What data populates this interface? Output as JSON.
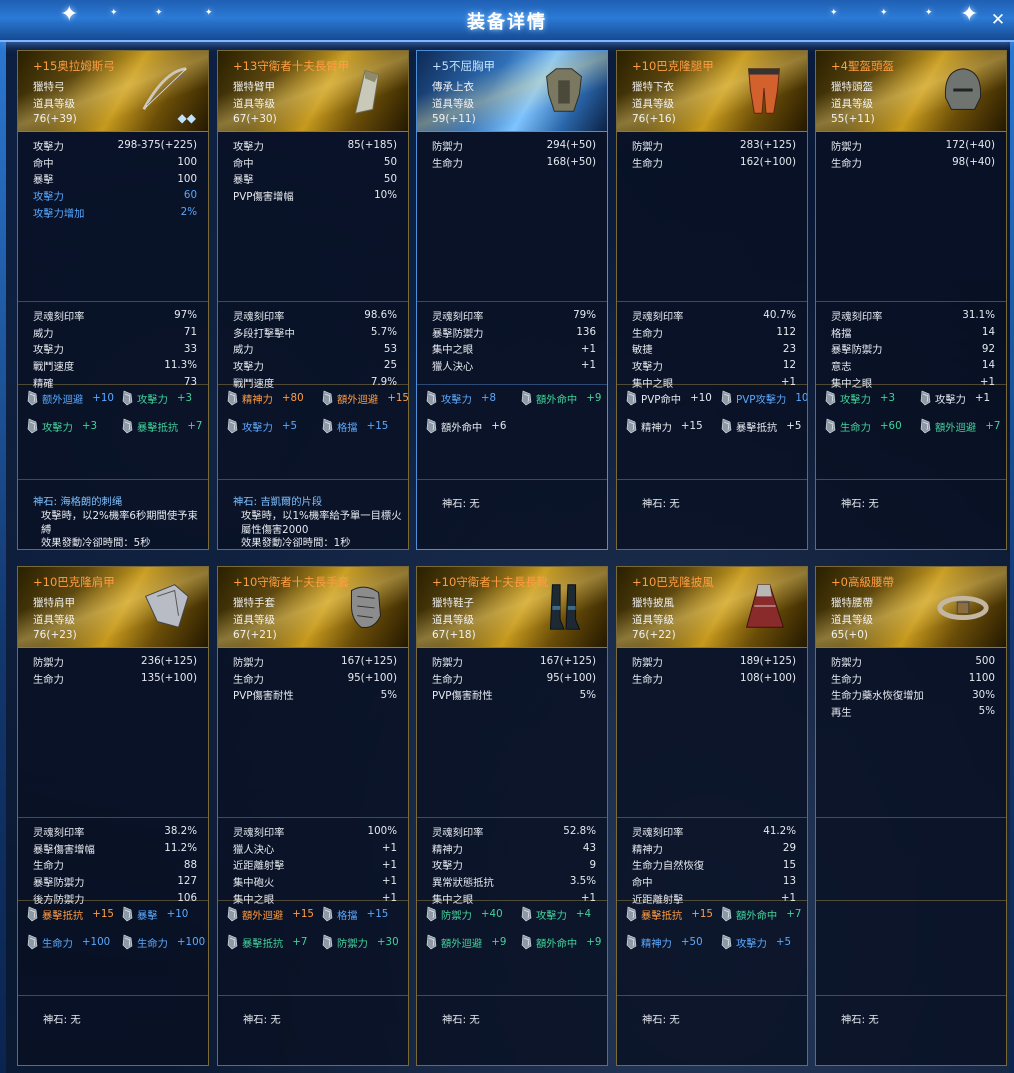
{
  "title": "装备详情",
  "cards": [
    {
      "theme": "gold",
      "name": "+15奥拉姆斯弓",
      "type": "獵特弓",
      "level_label": "道具等级",
      "level": "76(+39)",
      "stats": [
        [
          "攻擊力",
          "298-375(+225)"
        ],
        [
          "命中",
          "100"
        ],
        [
          "暴擊",
          "100"
        ],
        [
          "攻擊力",
          "60"
        ],
        [
          "攻擊力增加",
          "2%"
        ]
      ],
      "soul": [
        [
          "灵魂刻印率",
          "97%"
        ],
        [
          "威力",
          "71"
        ],
        [
          "攻擊力",
          "33"
        ],
        [
          "戰鬥速度",
          "11.3%"
        ],
        [
          "精確",
          "73"
        ]
      ],
      "bonus": [
        [
          "额外迴避",
          "+10",
          "blue"
        ],
        [
          "攻擊力",
          "+3",
          "green"
        ],
        [
          "攻擊力",
          "+3",
          "green"
        ],
        [
          "暴擊抵抗",
          "+7",
          "green"
        ]
      ],
      "stone": {
        "title": "神石: 海格朗的刺绳",
        "desc": "攻擊時，以2%機率6秒期間使予束縛\n效果發動冷卻時間：5秒\n穿戴多個相同的神石時，僅套用一個效果。"
      }
    },
    {
      "theme": "gold",
      "name": "+13守衛者十夫長臂甲",
      "type": "獵特臂甲",
      "level_label": "道具等级",
      "level": "67(+30)",
      "stats": [
        [
          "攻擊力",
          "85(+185)"
        ],
        [
          "命中",
          "50"
        ],
        [
          "暴擊",
          "50"
        ],
        [
          "PVP傷害增幅",
          "10%"
        ]
      ],
      "soul": [
        [
          "灵魂刻印率",
          "98.6%"
        ],
        [
          "多段打擊擊中",
          "5.7%"
        ],
        [
          "威力",
          "53"
        ],
        [
          "攻擊力",
          "25"
        ],
        [
          "戰鬥速度",
          "7.9%"
        ]
      ],
      "bonus": [
        [
          "精神力",
          "+80",
          "orange"
        ],
        [
          "額外迴避",
          "+15",
          "orange"
        ],
        [
          "攻擊力",
          "+5",
          "blue"
        ],
        [
          "格擋",
          "+15",
          "blue"
        ]
      ],
      "stone": {
        "title": "神石: 吉凱爾的片段",
        "desc": "攻擊時，以1%機率給予單一目標火屬性傷害2000\n效果發動冷卻時間：1秒\n穿戴多個相同的神石時，僅套用一個效果。"
      }
    },
    {
      "theme": "blue",
      "name": "+5不屈胸甲",
      "type": "傳承上衣",
      "level_label": "道具等级",
      "level": "59(+11)",
      "stats": [
        [
          "防禦力",
          "294(+50)"
        ],
        [
          "生命力",
          "168(+50)"
        ]
      ],
      "soul": [
        [
          "灵魂刻印率",
          "79%"
        ],
        [
          "暴擊防禦力",
          "136"
        ],
        [
          "集中之眼",
          "+1"
        ],
        [
          "獵人決心",
          "+1"
        ]
      ],
      "bonus": [
        [
          "攻擊力",
          "+8",
          "blue"
        ],
        [
          "額外命中",
          "+9",
          "green"
        ],
        [
          "額外命中",
          "+6",
          "white"
        ]
      ],
      "stone": {
        "title": "神石: 无",
        "desc": ""
      }
    },
    {
      "theme": "gold",
      "name": "+10巴克隆腿甲",
      "type": "獵特下衣",
      "level_label": "道具等级",
      "level": "76(+16)",
      "stats": [
        [
          "防禦力",
          "283(+125)"
        ],
        [
          "生命力",
          "162(+100)"
        ]
      ],
      "soul": [
        [
          "灵魂刻印率",
          "40.7%"
        ],
        [
          "生命力",
          "112"
        ],
        [
          "敏捷",
          "23"
        ],
        [
          "攻擊力",
          "12"
        ],
        [
          "集中之眼",
          "+1"
        ]
      ],
      "bonus": [
        [
          "PVP命中",
          "+10",
          "white"
        ],
        [
          "PVP攻擊力",
          "10",
          "blue"
        ],
        [
          "精神力",
          "+15",
          "white"
        ],
        [
          "暴擊抵抗",
          "+5",
          "white"
        ]
      ],
      "stone": {
        "title": "神石: 无",
        "desc": ""
      }
    },
    {
      "theme": "gold",
      "name": "+4聖盔頭盔",
      "type": "獵特頭盔",
      "level_label": "道具等级",
      "level": "55(+11)",
      "stats": [
        [
          "防禦力",
          "172(+40)"
        ],
        [
          "生命力",
          "98(+40)"
        ]
      ],
      "soul": [
        [
          "灵魂刻印率",
          "31.1%"
        ],
        [
          "格擋",
          "14"
        ],
        [
          "暴擊防禦力",
          "92"
        ],
        [
          "意志",
          "14"
        ],
        [
          "集中之眼",
          "+1"
        ]
      ],
      "bonus": [
        [
          "攻擊力",
          "+3",
          "green"
        ],
        [
          "攻擊力",
          "+1",
          "white"
        ],
        [
          "生命力",
          "+60",
          "green"
        ],
        [
          "額外迴避",
          "+7",
          "green"
        ]
      ],
      "stone": {
        "title": "神石: 无",
        "desc": ""
      }
    },
    {
      "theme": "gold",
      "name": "+10巴克隆肩甲",
      "type": "獵特肩甲",
      "level_label": "道具等级",
      "level": "76(+23)",
      "stats": [
        [
          "防禦力",
          "236(+125)"
        ],
        [
          "生命力",
          "135(+100)"
        ]
      ],
      "soul": [
        [
          "灵魂刻印率",
          "38.2%"
        ],
        [
          "暴擊傷害增幅",
          "11.2%"
        ],
        [
          "生命力",
          "88"
        ],
        [
          "暴擊防禦力",
          "127"
        ],
        [
          "後方防禦力",
          "106"
        ]
      ],
      "bonus": [
        [
          "暴擊抵抗",
          "+15",
          "orange"
        ],
        [
          "暴擊",
          "+10",
          "blue"
        ],
        [
          "生命力",
          "+100",
          "blue"
        ],
        [
          "生命力",
          "+100",
          "blue"
        ]
      ],
      "stone": {
        "title": "神石: 无",
        "desc": ""
      }
    },
    {
      "theme": "gold",
      "name": "+10守衛者十夫長手套",
      "type": "獵特手套",
      "level_label": "道具等级",
      "level": "67(+21)",
      "stats": [
        [
          "防禦力",
          "167(+125)"
        ],
        [
          "生命力",
          "95(+100)"
        ],
        [
          "PVP傷害耐性",
          "5%"
        ]
      ],
      "soul": [
        [
          "灵魂刻印率",
          "100%"
        ],
        [
          "獵人決心",
          "+1"
        ],
        [
          "近距離射擊",
          "+1"
        ],
        [
          "集中砲火",
          "+1"
        ],
        [
          "集中之眼",
          "+1"
        ]
      ],
      "bonus": [
        [
          "額外迴避",
          "+15",
          "orange"
        ],
        [
          "格擋",
          "+15",
          "blue"
        ],
        [
          "暴擊抵抗",
          "+7",
          "green"
        ],
        [
          "防禦力",
          "+30",
          "green"
        ]
      ],
      "stone": {
        "title": "神石: 无",
        "desc": ""
      }
    },
    {
      "theme": "gold",
      "name": "+10守衛者十夫長長靴",
      "type": "獵特鞋子",
      "level_label": "道具等级",
      "level": "67(+18)",
      "stats": [
        [
          "防禦力",
          "167(+125)"
        ],
        [
          "生命力",
          "95(+100)"
        ],
        [
          "PVP傷害耐性",
          "5%"
        ]
      ],
      "soul": [
        [
          "灵魂刻印率",
          "52.8%"
        ],
        [
          "精神力",
          "43"
        ],
        [
          "攻擊力",
          "9"
        ],
        [
          "異常狀態抵抗",
          "3.5%"
        ],
        [
          "集中之眼",
          "+1"
        ]
      ],
      "bonus": [
        [
          "防禦力",
          "+40",
          "green"
        ],
        [
          "攻擊力",
          "+4",
          "green"
        ],
        [
          "額外迴避",
          "+9",
          "green"
        ],
        [
          "額外命中",
          "+9",
          "green"
        ]
      ],
      "stone": {
        "title": "神石: 无",
        "desc": ""
      }
    },
    {
      "theme": "gold",
      "name": "+10巴克隆披風",
      "type": "獵特披風",
      "level_label": "道具等级",
      "level": "76(+22)",
      "stats": [
        [
          "防禦力",
          "189(+125)"
        ],
        [
          "生命力",
          "108(+100)"
        ]
      ],
      "soul": [
        [
          "灵魂刻印率",
          "41.2%"
        ],
        [
          "精神力",
          "29"
        ],
        [
          "生命力自然恢復",
          "15"
        ],
        [
          "命中",
          "13"
        ],
        [
          "近距離射擊",
          "+1"
        ]
      ],
      "bonus": [
        [
          "暴擊抵抗",
          "+15",
          "orange"
        ],
        [
          "額外命中",
          "+7",
          "green"
        ],
        [
          "精神力",
          "+50",
          "blue"
        ],
        [
          "攻擊力",
          "+5",
          "blue"
        ]
      ],
      "stone": {
        "title": "神石: 无",
        "desc": ""
      }
    },
    {
      "theme": "gold",
      "name": "+0高級腰帶",
      "type": "獵特腰帶",
      "level_label": "道具等级",
      "level": "65(+0)",
      "stats": [
        [
          "防禦力",
          "500"
        ],
        [
          "生命力",
          "1100"
        ],
        [
          "生命力藥水恢復增加",
          "30%"
        ],
        [
          "再生",
          "5%"
        ]
      ],
      "soul": [],
      "bonus": [],
      "stone": {
        "title": "神石: 无",
        "desc": ""
      }
    }
  ],
  "colors": {
    "gold_border": "#7a6a35",
    "name": "#ff9d42",
    "blue": "#5aaaff",
    "green": "#42d39b"
  },
  "icons": {
    "close": "close-icon",
    "bonus": "crystal-icon",
    "gem": "diamond-icon"
  }
}
